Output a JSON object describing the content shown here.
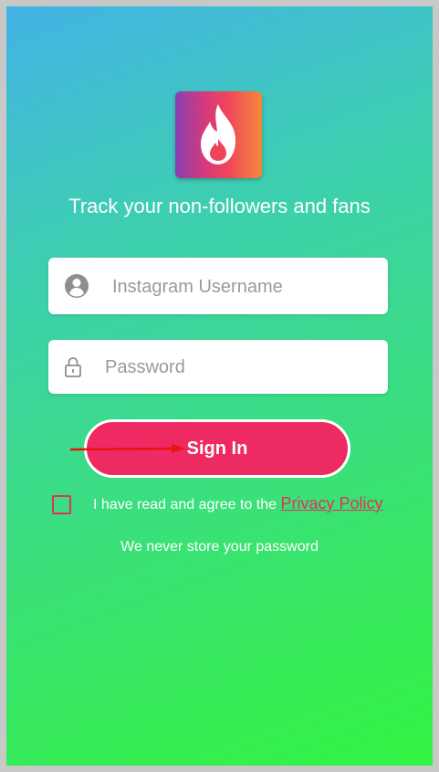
{
  "app": {
    "tagline": "Track your non-followers and fans",
    "logo_icon": "flame-icon",
    "brand_colors": {
      "accent": "#ee2a63",
      "policy_link": "#e03060"
    }
  },
  "form": {
    "username": {
      "placeholder": "Instagram Username",
      "value": "",
      "icon": "user-avatar-icon"
    },
    "password": {
      "placeholder": "Password",
      "value": "",
      "icon": "lock-icon"
    },
    "sign_in_label": "Sign In"
  },
  "agreement": {
    "checked": false,
    "text": "I have read and agree to the ",
    "policy_link": "Privacy Policy"
  },
  "note": "We never store your password"
}
